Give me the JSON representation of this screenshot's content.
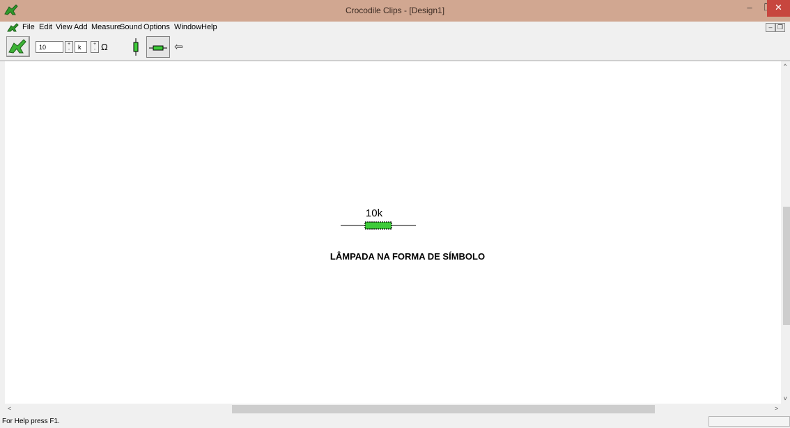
{
  "window": {
    "title": "Crocodile Clips - [Design1]",
    "minimize_glyph": "–",
    "maximize_glyph": "❐",
    "close_glyph": "✕",
    "accent": "#d1a791",
    "close_color": "#c7463e"
  },
  "menu": {
    "items": [
      "File",
      "Edit",
      "View",
      "Add",
      "Measure",
      "Sound",
      "Options",
      "Window",
      "Help"
    ],
    "mdi_minimize": "–",
    "mdi_restore": "❐"
  },
  "toolbar": {
    "value": "10",
    "multiplier": "k",
    "unit_symbol": "Ω",
    "arrow_glyph": "⇦",
    "component_color": "#3ecb3a"
  },
  "canvas": {
    "component_label": "10k",
    "caption": "LÂMPADA NA FORMA DE SÍMBOLO"
  },
  "scroll": {
    "up": "^",
    "down": "v",
    "left": "<",
    "right": ">"
  },
  "status": {
    "text": "For Help press F1."
  }
}
